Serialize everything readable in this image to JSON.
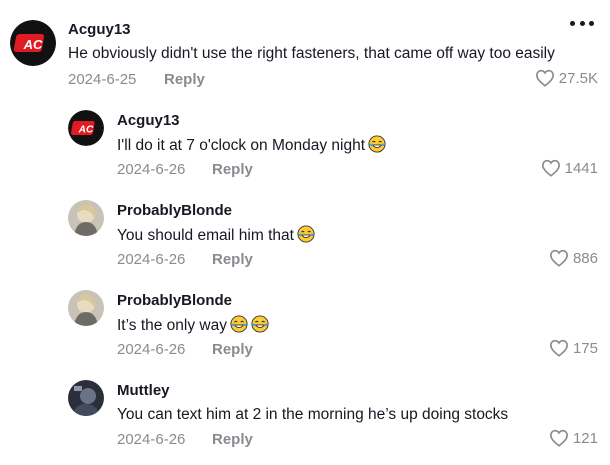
{
  "comments": [
    {
      "username": "Acguy13",
      "text": "He obviously didn't use the right fasteners, that came off way too easily",
      "date": "2024-6-25",
      "reply_label": "Reply",
      "likes": "27.5K",
      "avatar_text": "AC"
    },
    {
      "username": "Acguy13",
      "text": "I'll do it at 7 o'clock on Monday night",
      "date": "2024-6-26",
      "reply_label": "Reply",
      "likes": "1441",
      "avatar_text": "AC"
    },
    {
      "username": "ProbablyBlonde",
      "text": "You should email him that",
      "date": "2024-6-26",
      "reply_label": "Reply",
      "likes": "886"
    },
    {
      "username": "ProbablyBlonde",
      "text": "It’s the only way",
      "date": "2024-6-26",
      "reply_label": "Reply",
      "likes": "175"
    },
    {
      "username": "Muttley",
      "text": "You can text him at 2 in the morning he’s up doing stocks",
      "date": "2024-6-26",
      "reply_label": "Reply",
      "likes": "121"
    }
  ],
  "icons": {
    "like": "heart-outline-icon",
    "more": "more-horizontal-icon",
    "emoji": "laughing-tears-emoji"
  },
  "colors": {
    "text_primary": "#161823",
    "text_secondary": "#8a8b91",
    "logo_red": "#e01b24"
  }
}
